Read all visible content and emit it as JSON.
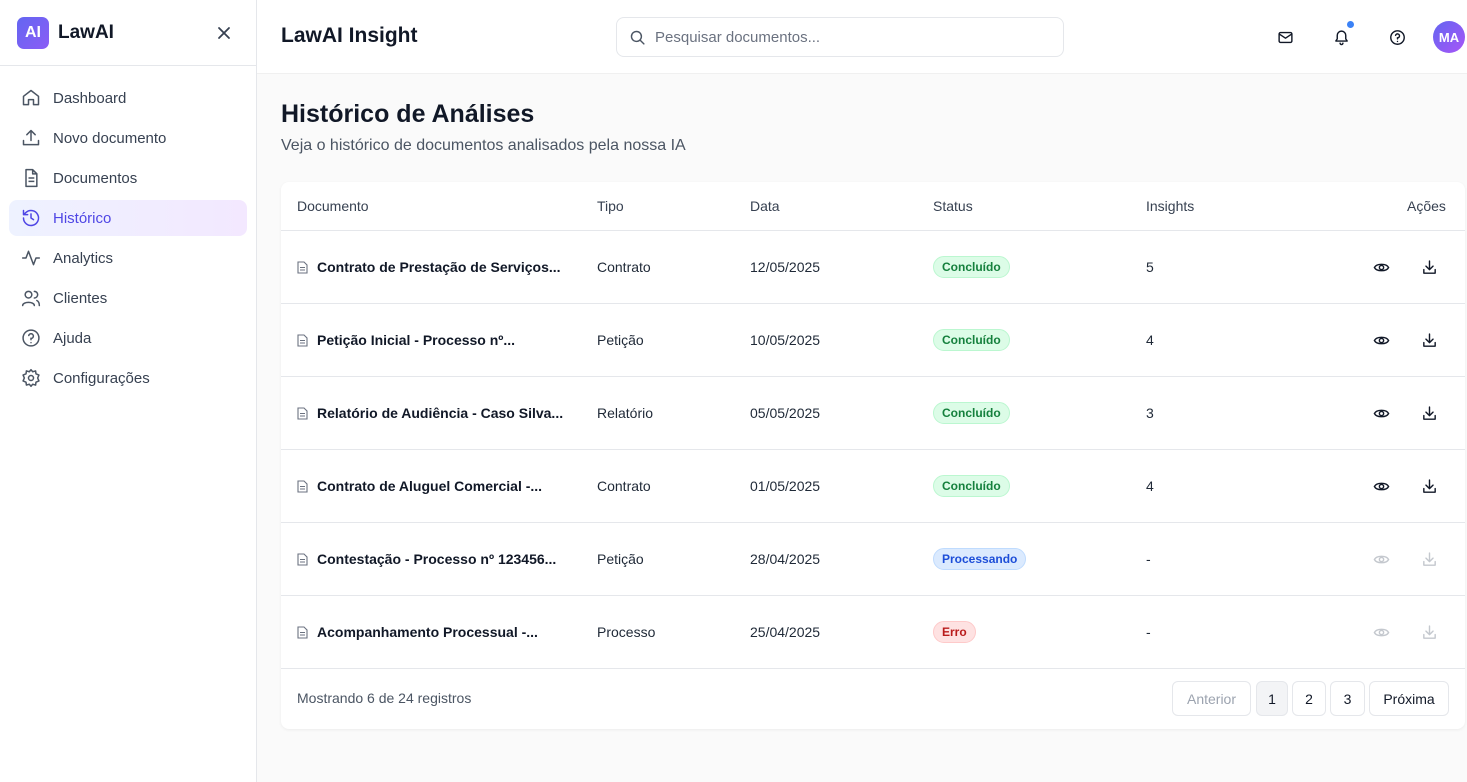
{
  "brand": {
    "logo_text": "AI",
    "name": "LawAI"
  },
  "sidebar": {
    "items": [
      {
        "label": "Dashboard",
        "icon": "home-icon"
      },
      {
        "label": "Novo documento",
        "icon": "upload-icon"
      },
      {
        "label": "Documentos",
        "icon": "file-text-icon"
      },
      {
        "label": "Histórico",
        "icon": "history-icon",
        "active": true
      },
      {
        "label": "Analytics",
        "icon": "activity-icon"
      },
      {
        "label": "Clientes",
        "icon": "users-icon"
      },
      {
        "label": "Ajuda",
        "icon": "help-circle-icon"
      },
      {
        "label": "Configurações",
        "icon": "settings-icon"
      }
    ]
  },
  "header": {
    "title": "LawAI Insight",
    "search_placeholder": "Pesquisar documentos...",
    "avatar_initials": "MA"
  },
  "page": {
    "title": "Histórico de Análises",
    "subtitle": "Veja o histórico de documentos analisados pela nossa IA"
  },
  "table": {
    "columns": [
      "Documento",
      "Tipo",
      "Data",
      "Status",
      "Insights",
      "Ações"
    ],
    "rows": [
      {
        "document": "Contrato de Prestação de Serviços...",
        "type": "Contrato",
        "date": "12/05/2025",
        "status": "Concluído",
        "status_kind": "ok",
        "insights": "5"
      },
      {
        "document": "Petição Inicial - Processo nº...",
        "type": "Petição",
        "date": "10/05/2025",
        "status": "Concluído",
        "status_kind": "ok",
        "insights": "4"
      },
      {
        "document": "Relatório de Audiência - Caso Silva...",
        "type": "Relatório",
        "date": "05/05/2025",
        "status": "Concluído",
        "status_kind": "ok",
        "insights": "3"
      },
      {
        "document": "Contrato de Aluguel Comercial -...",
        "type": "Contrato",
        "date": "01/05/2025",
        "status": "Concluído",
        "status_kind": "ok",
        "insights": "4"
      },
      {
        "document": "Contestação - Processo nº 123456...",
        "type": "Petição",
        "date": "28/04/2025",
        "status": "Processando",
        "status_kind": "proc",
        "insights": "-"
      },
      {
        "document": "Acompanhamento Processual -...",
        "type": "Processo",
        "date": "25/04/2025",
        "status": "Erro",
        "status_kind": "err",
        "insights": "-"
      }
    ]
  },
  "footer": {
    "showing": "Mostrando 6 de 24 registros",
    "prev": "Anterior",
    "pages": [
      "1",
      "2",
      "3"
    ],
    "next": "Próxima"
  },
  "colors": {
    "accent": "#4f46e5",
    "ok": "#15803d",
    "processing": "#1d4ed8",
    "error": "#b91c1c",
    "notification_dot": "#3b82f6"
  }
}
